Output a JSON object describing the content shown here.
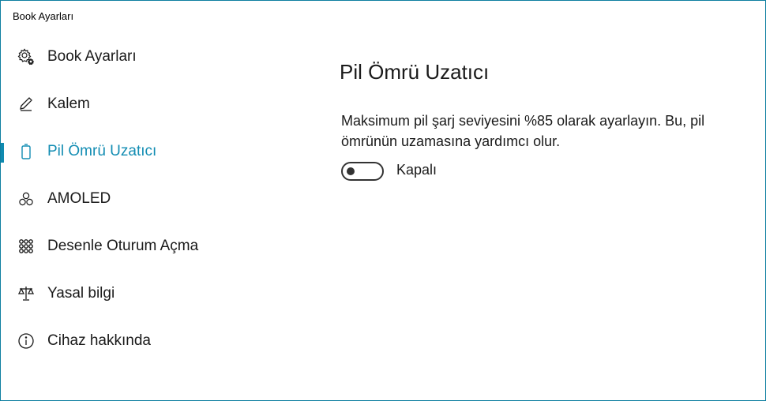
{
  "window": {
    "title": "Book Ayarları"
  },
  "sidebar": {
    "items": [
      {
        "label": "Book Ayarları",
        "icon": "gear-icon",
        "selected": false
      },
      {
        "label": "Kalem",
        "icon": "pen-icon",
        "selected": false
      },
      {
        "label": "Pil Ömrü Uzatıcı",
        "icon": "battery-icon",
        "selected": true
      },
      {
        "label": "AMOLED",
        "icon": "circles-icon",
        "selected": false
      },
      {
        "label": "Desenle Oturum Açma",
        "icon": "pattern-grid-icon",
        "selected": false
      },
      {
        "label": "Yasal bilgi",
        "icon": "scales-icon",
        "selected": false
      },
      {
        "label": "Cihaz hakkında",
        "icon": "info-icon",
        "selected": false
      }
    ]
  },
  "main": {
    "title": "Pil Ömrü Uzatıcı",
    "description": "Maksimum pil şarj seviyesini %85 olarak ayarlayın. Bu, pil ömrünün uzamasına yardımcı olur.",
    "toggle": {
      "state": "off",
      "label": "Kapalı"
    }
  },
  "colors": {
    "accent": "#138db3",
    "window_border": "#0e7fa0",
    "text": "#1a1a1a"
  }
}
